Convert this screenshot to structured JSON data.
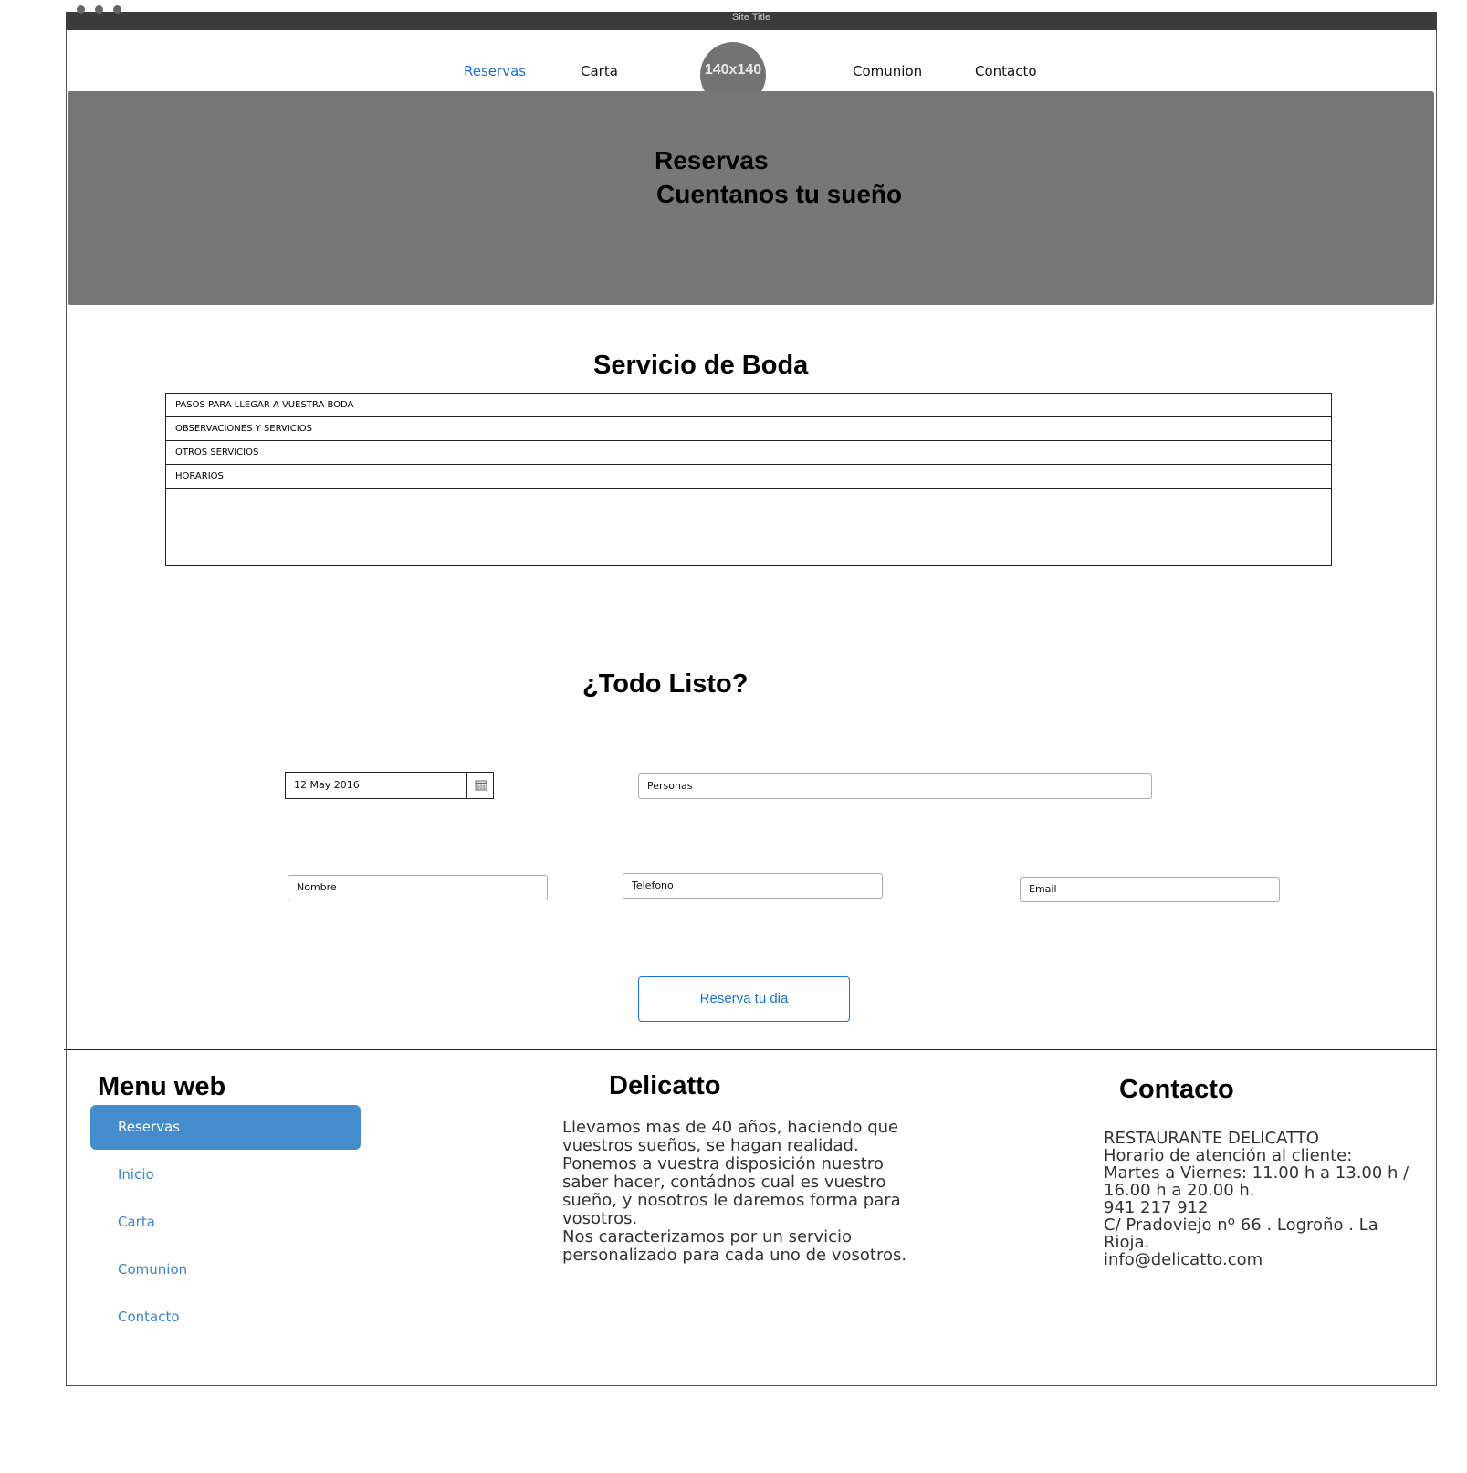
{
  "window": {
    "title": "Site Title"
  },
  "nav": {
    "items": [
      {
        "label": "Reservas",
        "active": true
      },
      {
        "label": "Carta",
        "active": false
      },
      {
        "label": "Comunion",
        "active": false
      },
      {
        "label": "Contacto",
        "active": false
      }
    ],
    "logo_placeholder": "140x140"
  },
  "hero": {
    "title": "Reservas",
    "subtitle": "Cuentanos tu sueño",
    "background_color": "#777777"
  },
  "wedding_service": {
    "heading": "Servicio de Boda",
    "accordion": [
      "PASOS PARA LLEGAR A VUESTRA BODA",
      "OBSERVACIONES Y SERVICIOS",
      "OTROS SERVICIOS",
      "HORARIOS"
    ]
  },
  "booking": {
    "heading": "¿Todo Listo?",
    "date_value": "12 May 2016",
    "date_icon": "calendar-icon",
    "people_placeholder": "Personas",
    "name_placeholder": "Nombre",
    "phone_placeholder": "Telefono",
    "email_placeholder": "Email",
    "submit_label": "Reserva tu dia",
    "accent_color": "#1a73d0"
  },
  "footer": {
    "menu": {
      "heading": "Menu web",
      "items": [
        {
          "label": "Reservas",
          "active": true
        },
        {
          "label": "Inicio",
          "active": false
        },
        {
          "label": "Carta",
          "active": false
        },
        {
          "label": "Comunion",
          "active": false
        },
        {
          "label": "Contacto",
          "active": false
        }
      ],
      "active_color": "#448ccc"
    },
    "about": {
      "heading": "Delicatto",
      "lines": [
        "Llevamos mas de 40 años, haciendo que",
        "vuestros sueños, se hagan realidad.",
        "Ponemos a vuestra disposición nuestro",
        "saber hacer, contádnos cual es vuestro",
        "sueño, y nosotros le daremos forma para",
        "vosotros.",
        "Nos caracterizamos por un servicio",
        "personalizado para cada uno de vosotros."
      ]
    },
    "contact": {
      "heading": "Contacto",
      "lines": [
        "RESTAURANTE DELICATTO",
        "Horario de atención al cliente:",
        "Martes a Viernes: 11.00 h a 13.00 h /",
        "16.00 h a 20.00 h.",
        "941 217 912",
        "C/ Pradoviejo nº 66 . Logroño . La",
        "Rioja.",
        "info@delicatto.com"
      ]
    }
  }
}
